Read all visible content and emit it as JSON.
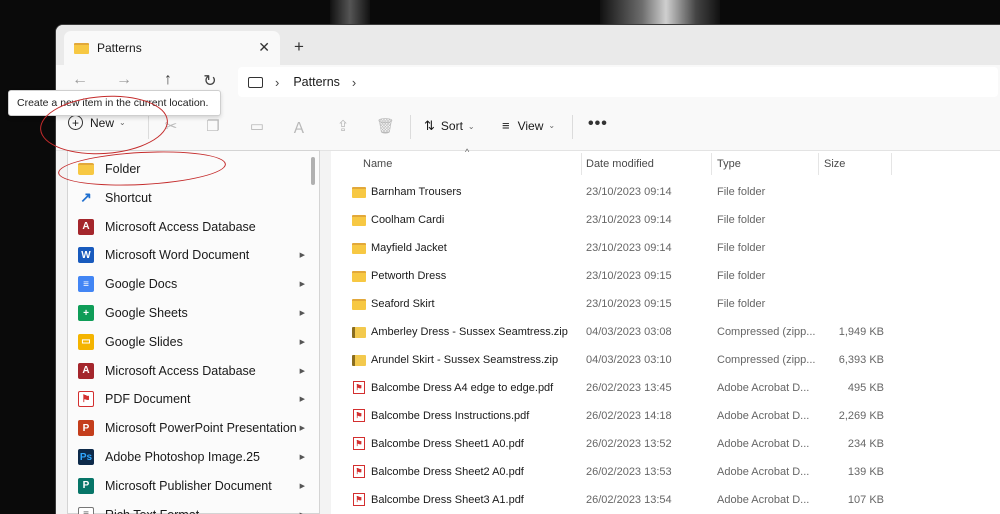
{
  "window": {
    "tab_title": "Patterns",
    "tab_close_icon": "close-icon",
    "new_tab_icon": "plus-icon"
  },
  "navigation": {
    "back_icon": "arrow-left-icon",
    "forward_icon": "arrow-right-icon",
    "up_icon": "arrow-up-icon",
    "refresh_icon": "refresh-icon",
    "breadcrumb": [
      "Patterns"
    ]
  },
  "toolbar": {
    "new_label": "New",
    "sort_label": "Sort",
    "view_label": "View",
    "more_label": "•••",
    "tooltip": "Create a new item in the current location."
  },
  "new_menu": {
    "items": [
      {
        "label": "Folder",
        "icon": "folder-icon",
        "has_submenu": false
      },
      {
        "label": "Shortcut",
        "icon": "shortcut-icon",
        "has_submenu": false
      },
      {
        "label": "Microsoft Access Database",
        "icon": "access-icon",
        "has_submenu": false
      },
      {
        "label": "Microsoft Word Document",
        "icon": "word-icon",
        "has_submenu": true
      },
      {
        "label": "Google Docs",
        "icon": "google-docs-icon",
        "has_submenu": true
      },
      {
        "label": "Google Sheets",
        "icon": "google-sheets-icon",
        "has_submenu": true
      },
      {
        "label": "Google Slides",
        "icon": "google-slides-icon",
        "has_submenu": true
      },
      {
        "label": "Microsoft Access Database",
        "icon": "access-icon",
        "has_submenu": true
      },
      {
        "label": "PDF Document",
        "icon": "pdf-icon",
        "has_submenu": true
      },
      {
        "label": "Microsoft PowerPoint Presentation",
        "icon": "powerpoint-icon",
        "has_submenu": true
      },
      {
        "label": "Adobe Photoshop Image.25",
        "icon": "photoshop-icon",
        "has_submenu": true
      },
      {
        "label": "Microsoft Publisher Document",
        "icon": "publisher-icon",
        "has_submenu": true
      },
      {
        "label": "Rich Text Format",
        "icon": "rtf-icon",
        "has_submenu": true
      }
    ]
  },
  "file_list": {
    "columns": {
      "name": "Name",
      "date": "Date modified",
      "type": "Type",
      "size": "Size"
    },
    "rows": [
      {
        "name": "Barnham Trousers",
        "date": "23/10/2023 09:14",
        "type": "File folder",
        "size": "",
        "kind": "folder"
      },
      {
        "name": "Coolham Cardi",
        "date": "23/10/2023 09:14",
        "type": "File folder",
        "size": "",
        "kind": "folder"
      },
      {
        "name": "Mayfield Jacket",
        "date": "23/10/2023 09:14",
        "type": "File folder",
        "size": "",
        "kind": "folder"
      },
      {
        "name": "Petworth Dress",
        "date": "23/10/2023 09:15",
        "type": "File folder",
        "size": "",
        "kind": "folder"
      },
      {
        "name": "Seaford Skirt",
        "date": "23/10/2023 09:15",
        "type": "File folder",
        "size": "",
        "kind": "folder"
      },
      {
        "name": "Amberley Dress - Sussex Seamtress.zip",
        "date": "04/03/2023 03:08",
        "type": "Compressed (zipp...",
        "size": "1,949 KB",
        "kind": "zip"
      },
      {
        "name": "Arundel Skirt - Sussex Seamstress.zip",
        "date": "04/03/2023 03:10",
        "type": "Compressed (zipp...",
        "size": "6,393 KB",
        "kind": "zip"
      },
      {
        "name": "Balcombe Dress A4 edge to edge.pdf",
        "date": "26/02/2023 13:45",
        "type": "Adobe Acrobat D...",
        "size": "495 KB",
        "kind": "pdf"
      },
      {
        "name": "Balcombe Dress Instructions.pdf",
        "date": "26/02/2023 14:18",
        "type": "Adobe Acrobat D...",
        "size": "2,269 KB",
        "kind": "pdf"
      },
      {
        "name": "Balcombe Dress Sheet1 A0.pdf",
        "date": "26/02/2023 13:52",
        "type": "Adobe Acrobat D...",
        "size": "234 KB",
        "kind": "pdf"
      },
      {
        "name": "Balcombe Dress Sheet2 A0.pdf",
        "date": "26/02/2023 13:53",
        "type": "Adobe Acrobat D...",
        "size": "139 KB",
        "kind": "pdf"
      },
      {
        "name": "Balcombe Dress Sheet3 A1.pdf",
        "date": "26/02/2023 13:54",
        "type": "Adobe Acrobat D...",
        "size": "107 KB",
        "kind": "pdf"
      }
    ]
  },
  "colors": {
    "annotation": "#c42b2b",
    "folder": "#f7c843",
    "pdf": "#d32f2f"
  }
}
